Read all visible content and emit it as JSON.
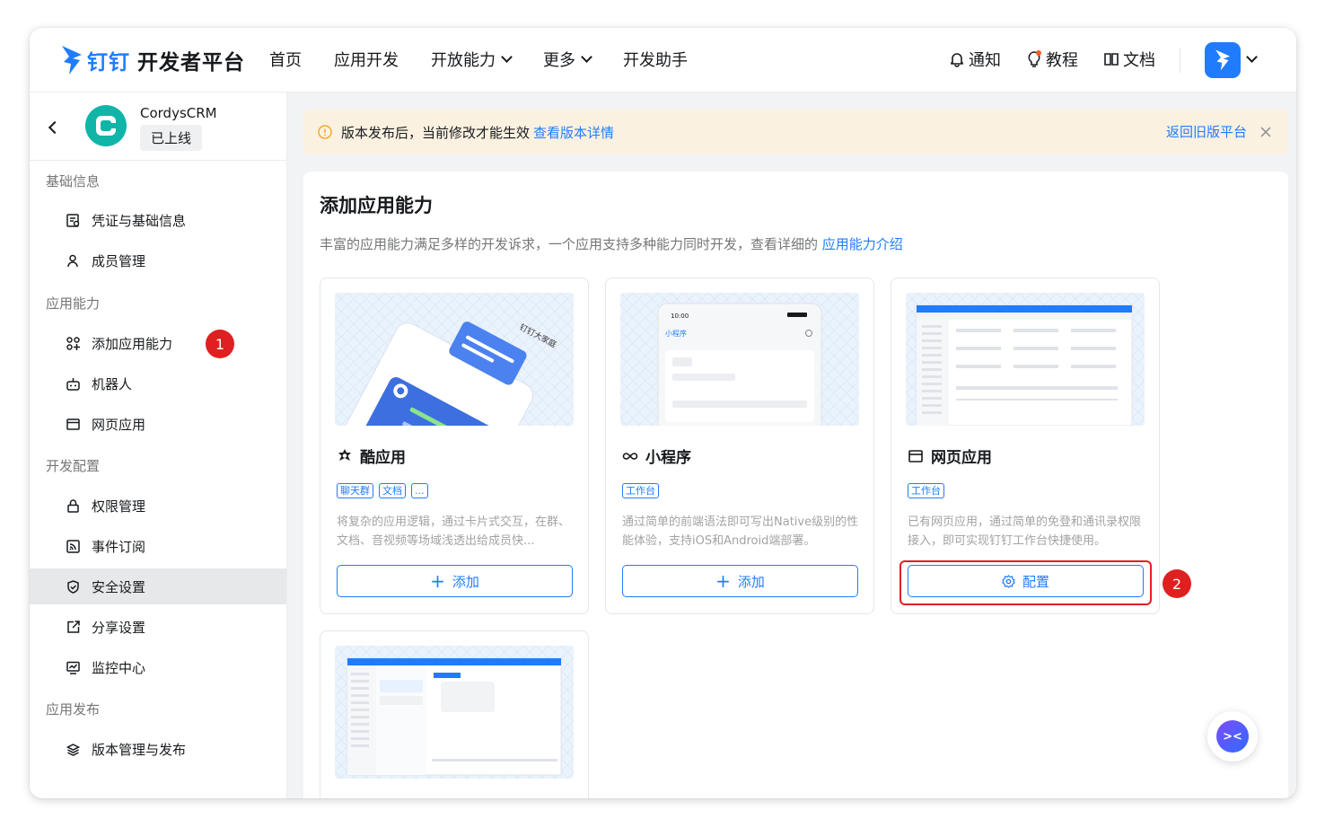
{
  "brand": {
    "name_blue": "钉钉",
    "name": "开发者平台"
  },
  "nav": {
    "links": [
      {
        "label": "首页"
      },
      {
        "label": "应用开发"
      },
      {
        "label": "开放能力"
      },
      {
        "label": "更多"
      },
      {
        "label": "开发助手"
      }
    ],
    "right": {
      "notify": "通知",
      "tutorial": "教程",
      "docs": "文档"
    }
  },
  "app": {
    "name": "CordysCRM",
    "status": "已上线"
  },
  "sidebar": {
    "sections": [
      {
        "title": "基础信息"
      },
      {
        "title": "应用能力"
      },
      {
        "title": "开发配置"
      },
      {
        "title": "应用发布"
      }
    ],
    "items": [
      {
        "label": "凭证与基础信息",
        "icon": "credential-icon"
      },
      {
        "label": "成员管理",
        "icon": "member-icon"
      },
      {
        "label": "添加应用能力",
        "icon": "grid-add-icon"
      },
      {
        "label": "机器人",
        "icon": "robot-icon"
      },
      {
        "label": "网页应用",
        "icon": "webpage-icon"
      },
      {
        "label": "权限管理",
        "icon": "lock-icon"
      },
      {
        "label": "事件订阅",
        "icon": "rss-icon"
      },
      {
        "label": "安全设置",
        "icon": "shield-icon"
      },
      {
        "label": "分享设置",
        "icon": "share-icon"
      },
      {
        "label": "监控中心",
        "icon": "monitor-icon"
      },
      {
        "label": "版本管理与发布",
        "icon": "layers-icon"
      }
    ],
    "step_badge": "1"
  },
  "notice": {
    "text": "版本发布后，当前修改才能生效",
    "link": "查看版本详情",
    "back_link": "返回旧版平台"
  },
  "panel": {
    "title": "添加应用能力",
    "desc": "丰富的应用能力满足多样的开发诉求，一个应用支持多种能力同时开发，查看详细的",
    "desc_link": "应用能力介绍"
  },
  "cards": [
    {
      "title": "酷应用",
      "tags": [
        "聊天群",
        "文档",
        "..."
      ],
      "desc": "将复杂的应用逻辑，通过卡片式交互，在群、文档、音视频等场域浅透出给成员快...",
      "button": "添加"
    },
    {
      "title": "小程序",
      "tags": [
        "工作台"
      ],
      "desc": "通过简单的前端语法即可写出Native级别的性能体验，支持iOS和Android端部署。",
      "button": "添加",
      "preview_time": "10:00",
      "preview_title": "小程序"
    },
    {
      "title": "网页应用",
      "tags": [
        "工作台"
      ],
      "desc": "已有网页应用，通过简单的免登和通讯录权限接入，即可实现钉钉工作台快捷使用。",
      "button": "配置"
    }
  ],
  "card1_img_text": "钉钉大家庭",
  "step2_badge": "2",
  "fab_label": "><",
  "colors": {
    "accent": "#1f7cff",
    "highlight": "#e02020",
    "notice_bg": "#fbf1e1"
  }
}
